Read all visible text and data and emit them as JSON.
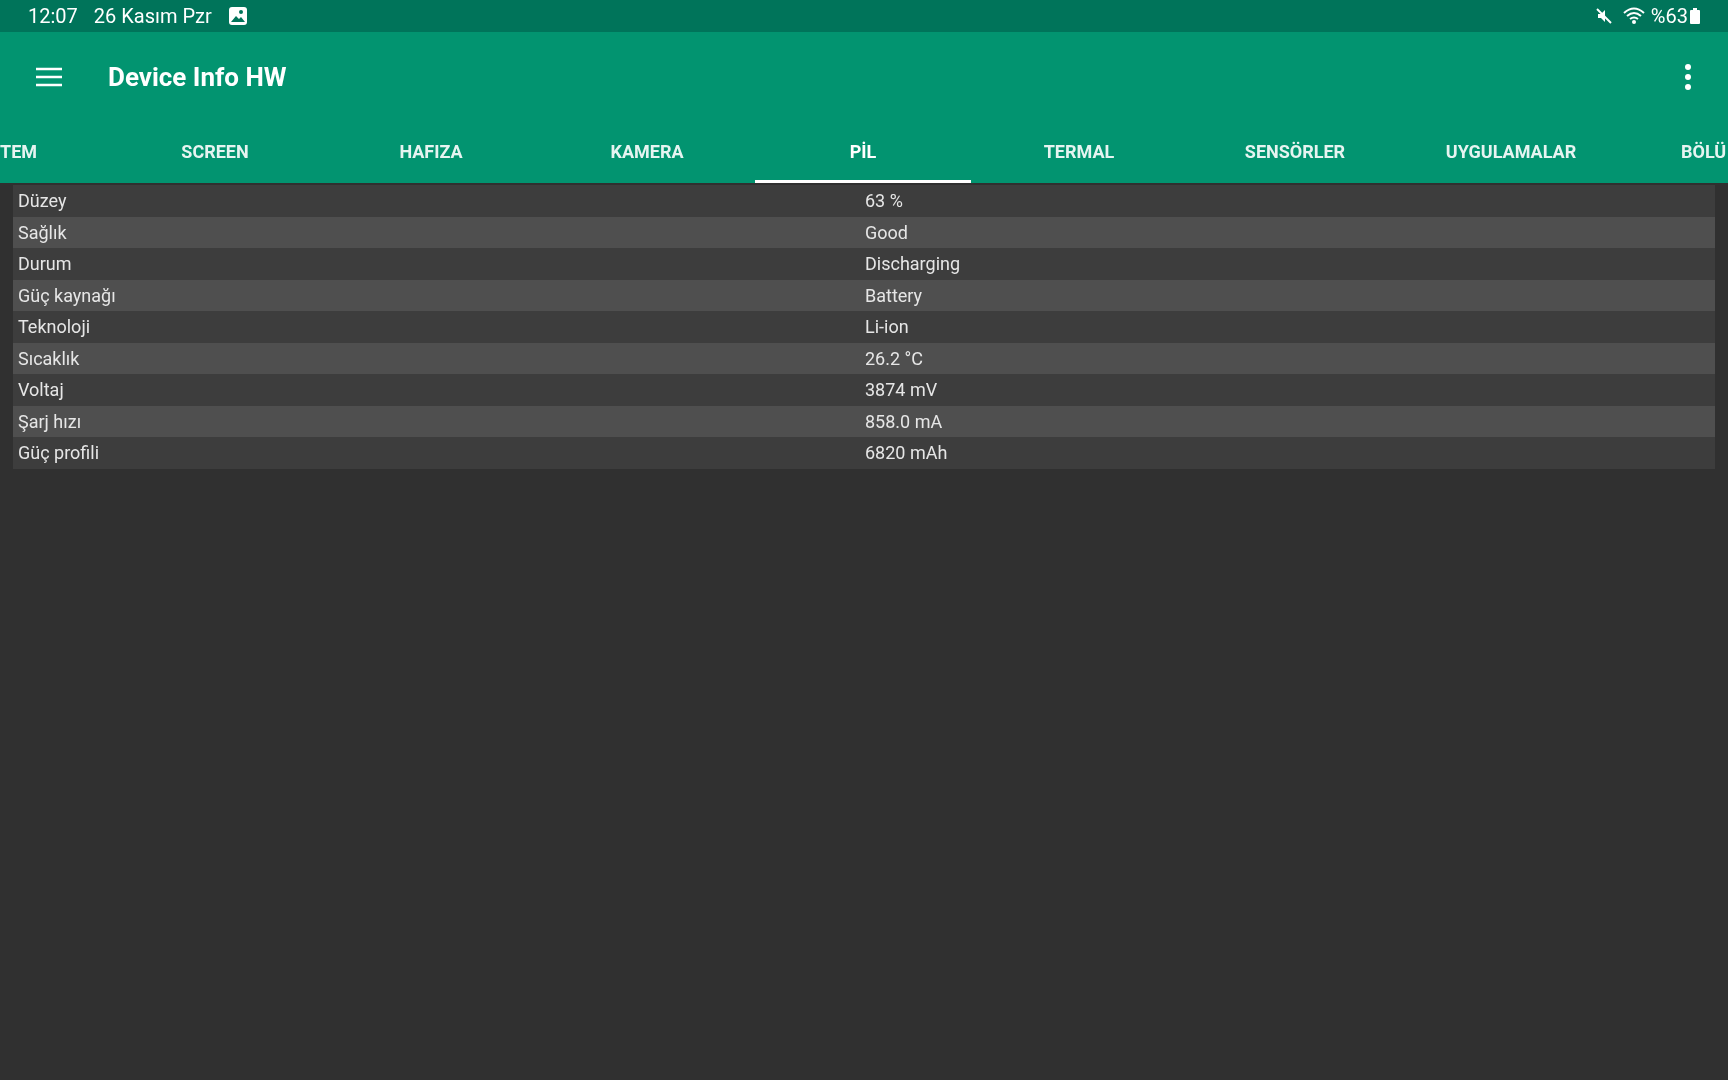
{
  "status_bar": {
    "time": "12:07",
    "date": "26 Kasım Pzr",
    "battery": "%63"
  },
  "app_bar": {
    "title": "Device Info HW"
  },
  "tabs": [
    {
      "label": "TEM",
      "selected": false
    },
    {
      "label": "SCREEN",
      "selected": false
    },
    {
      "label": "HAFIZA",
      "selected": false
    },
    {
      "label": "KAMERA",
      "selected": false
    },
    {
      "label": "PİL",
      "selected": true
    },
    {
      "label": "TERMAL",
      "selected": false
    },
    {
      "label": "SENSÖRLER",
      "selected": false
    },
    {
      "label": "UYGULAMALAR",
      "selected": false
    },
    {
      "label": "BÖLÜ",
      "selected": false
    }
  ],
  "rows": [
    {
      "label": "Düzey",
      "value": "63 %"
    },
    {
      "label": "Sağlık",
      "value": "Good"
    },
    {
      "label": "Durum",
      "value": "Discharging"
    },
    {
      "label": "Güç kaynağı",
      "value": "Battery"
    },
    {
      "label": "Teknoloji",
      "value": "Li-ion"
    },
    {
      "label": "Sıcaklık",
      "value": "26.2 °C"
    },
    {
      "label": "Voltaj",
      "value": "3874 mV"
    },
    {
      "label": "Şarj hızı",
      "value": "858.0 mA"
    },
    {
      "label": "Güç profili",
      "value": "6820 mAh"
    }
  ]
}
